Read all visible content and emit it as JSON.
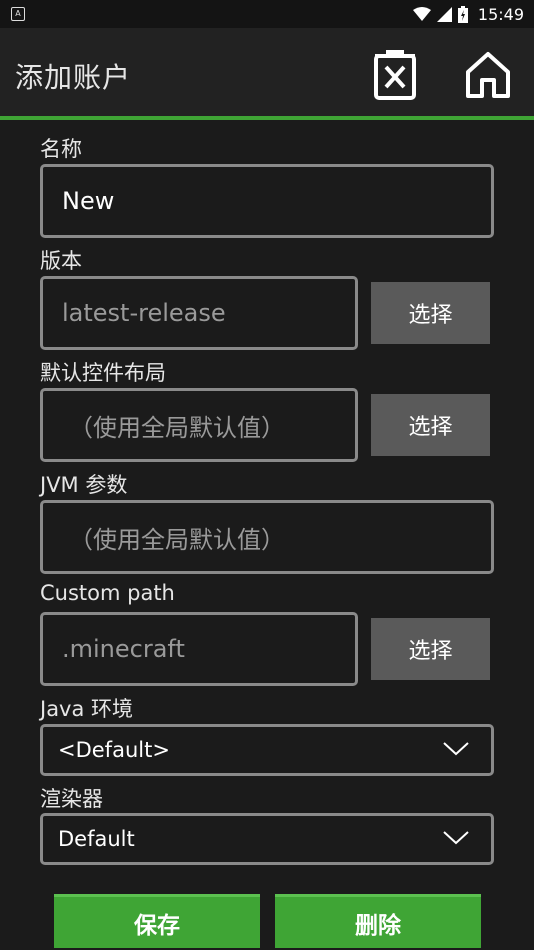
{
  "status": {
    "time": "15:49",
    "left_icon_label": "A"
  },
  "header": {
    "title": "添加账户"
  },
  "icons": {
    "delete": "delete-file-icon",
    "home": "home-icon"
  },
  "fields": {
    "name": {
      "label": "名称",
      "value": "New"
    },
    "version": {
      "label": "版本",
      "value": "latest-release",
      "button": "选择"
    },
    "control_layout": {
      "label": "默认控件布局",
      "placeholder": "（使用全局默认值）",
      "button": "选择"
    },
    "jvm": {
      "label": "JVM 参数",
      "placeholder": "（使用全局默认值）"
    },
    "custom_path": {
      "label": "Custom path",
      "placeholder": ".minecraft",
      "button": "选择"
    },
    "java": {
      "label": "Java 环境",
      "selected": "<Default>"
    },
    "renderer": {
      "label": "渲染器",
      "selected": "Default"
    }
  },
  "actions": {
    "save": "保存",
    "delete": "删除"
  },
  "colors": {
    "accent": "#3fa535",
    "background": "#1b1b1b",
    "button_grey": "#5a5a5a"
  }
}
